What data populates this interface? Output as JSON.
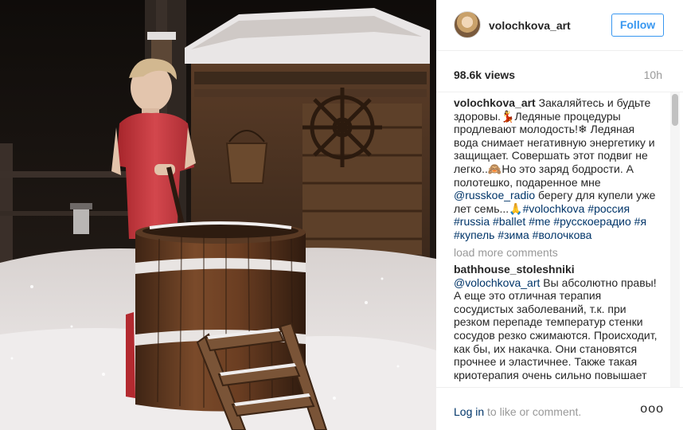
{
  "post": {
    "username": "volochkova_art",
    "follow_label": "Follow",
    "views": "98.6k views",
    "time_ago": "10h"
  },
  "caption": {
    "username": "volochkova_art",
    "text_1": "Закаляйтесь и будьте здоровы.",
    "emoji_dress": "💃",
    "text_2": "Ледяные процедуры продлевают молодость!",
    "emoji_snow": "❄",
    "text_3": "Ледяная вода снимает негативную энергетику и защищает. Совершать этот подвиг не легко..",
    "emoji_monkey": "🙈",
    "text_4": "Но это заряд бодрости. А полотешко, подаренное мне",
    "mention": "@russkoe_radio",
    "text_5": "берегу для купели уже лет семь...",
    "emoji_hands": "🙏",
    "hashtags": [
      "#volochkova",
      "#россия",
      "#russia",
      "#ballet",
      "#me",
      "#русскоерадио",
      "#я",
      "#купель",
      "#зима",
      "#волочкова"
    ]
  },
  "load_more_label": "load more comments",
  "reply": {
    "username": "bathhouse_stoleshniki",
    "mention": "@volochkova_art",
    "text": "Вы абсолютно правы! А еще это отличная терапия сосудистых заболеваний, т.к. при резком перепаде температур стенки сосудов резко сжимаются. Происходит, как бы, их накачка. Они становятся прочнее и эластичнее. Также такая криотерапия очень сильно повышает"
  },
  "footer": {
    "login_label": "Log in",
    "rest_label": "to like or comment.",
    "more_label": "ooo"
  },
  "colors": {
    "link": "#003569",
    "follow_blue": "#3897f0",
    "muted": "#999999",
    "text": "#262626"
  },
  "icons": {
    "avatar": "avatar",
    "more": "more-options-icon"
  }
}
